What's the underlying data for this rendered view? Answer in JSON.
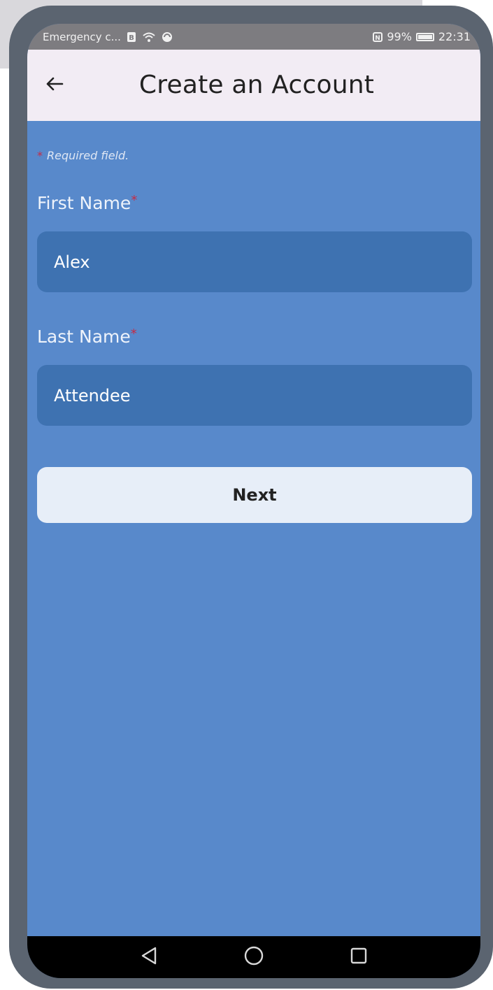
{
  "status_bar": {
    "carrier": "Emergency c...",
    "battery": "99%",
    "time": "22:31"
  },
  "app_bar": {
    "title": "Create an Account"
  },
  "form": {
    "required_note": "Required field.",
    "required_marker": "*",
    "first_name": {
      "label": "First Name",
      "value": "Alex"
    },
    "last_name": {
      "label": "Last Name",
      "value": "Attendee"
    },
    "next_label": "Next"
  },
  "colors": {
    "background": "#5889cb",
    "input_bg": "#3e72b1",
    "app_bar_bg": "#f2ecf4",
    "button_bg": "#e7eef8",
    "required_star": "#c62b44"
  },
  "icons": {
    "back": "arrow-left-icon",
    "nav_back": "triangle-back-icon",
    "nav_home": "circle-home-icon",
    "nav_recents": "square-recents-icon"
  }
}
